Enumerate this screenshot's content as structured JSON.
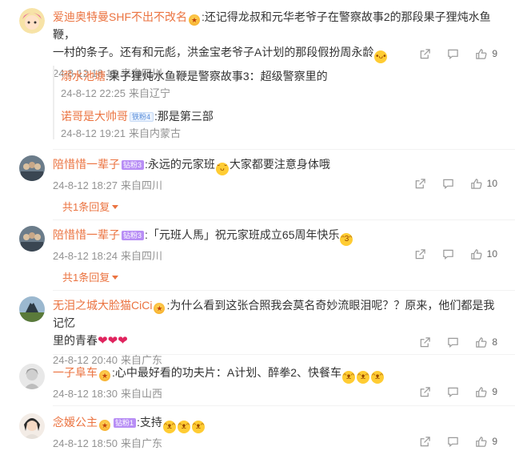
{
  "comments": [
    {
      "user": "爱迪奥特曼SHF不出不改名",
      "text_line1": ":还记得龙叔和元华老爷子在警察故事2的那段果子狸炖水鱼鞭，",
      "text_line2": "一村的条子。还有和元彪，洪金宝老爷子A计划的那段假扮周永龄",
      "date": "24-8-12 18:15",
      "location": "来自四川",
      "likes": "9",
      "replies": [
        {
          "user": "溺水池塘",
          "text": ":果子狸炖水鱼鞭是警察故事3：超级警察里的",
          "date": "24-8-12 22:25",
          "location": "来自辽宁"
        },
        {
          "user": "诺哥是大帅哥",
          "badge": "铁粉4",
          "text": ":那是第三部",
          "date": "24-8-12 19:21",
          "location": "来自内蒙古"
        }
      ]
    },
    {
      "user": "陪惜惜一辈子",
      "badge": "钻粉3",
      "text": ":永远的元家班",
      "text_after": "大家都要注意身体哦",
      "date": "24-8-12 18:27",
      "location": "来自四川",
      "likes": "10",
      "more": "共1条回复"
    },
    {
      "user": "陪惜惜一辈子",
      "badge": "钻粉3",
      "text": ":「元班人馬」祝元家班成立65周年快乐",
      "date": "24-8-12 18:24",
      "location": "来自四川",
      "likes": "10",
      "more": "共1条回复"
    },
    {
      "user": "无泪之城大脸猫CiCi",
      "text_line1": ":为什么看到这张合照我会莫名奇妙流眼泪呢？？原来，他们都是我记忆",
      "text_line2": "里的青春",
      "date": "24-8-12 20:40",
      "location": "来自广东",
      "likes": "8"
    },
    {
      "user": "一子阜车",
      "text": ":心中最好看的功夫片：A计划、醉拳2、快餐车",
      "date": "24-8-12 18:30",
      "location": "来自山西",
      "likes": "9"
    },
    {
      "user": "念嫒公主",
      "badge": "钻粉1",
      "text": ":支持",
      "date": "24-8-12 18:50",
      "location": "来自广东",
      "likes": "9"
    }
  ],
  "colors": {
    "username": "#eb7340",
    "meta": "#939393",
    "badge_purple": "#b88ef5"
  },
  "icons": [
    "share-icon",
    "comment-icon",
    "like-icon",
    "caret-down-icon"
  ]
}
